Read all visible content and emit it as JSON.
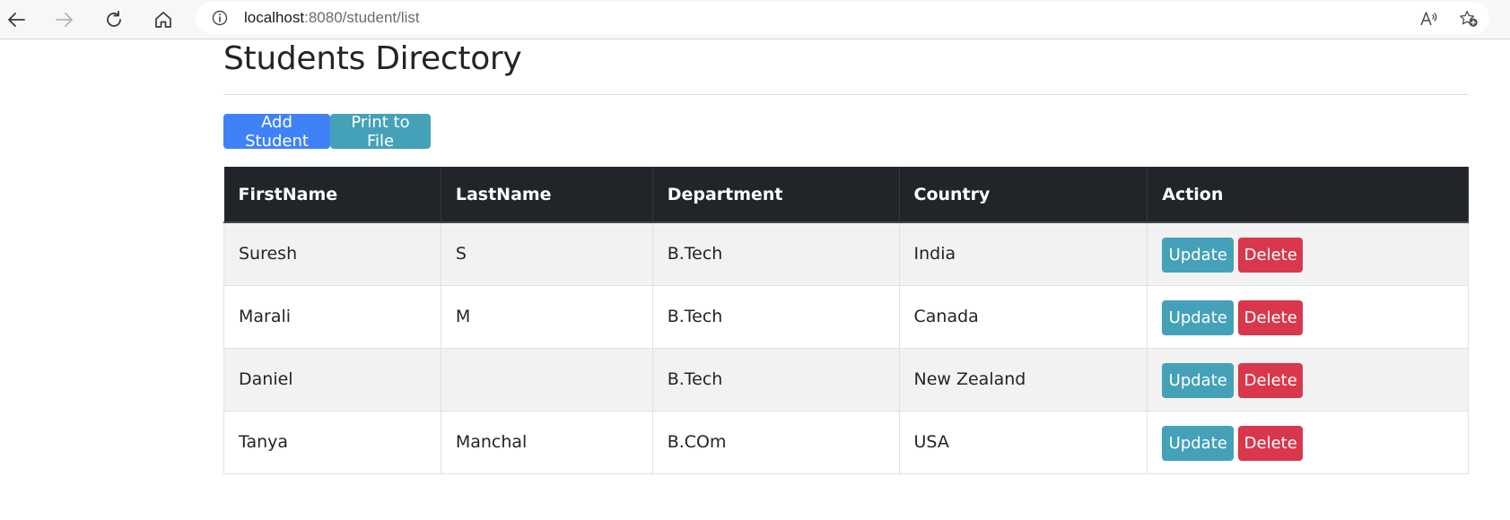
{
  "browser": {
    "url_host": "localhost",
    "url_path": ":8080/student/list"
  },
  "page": {
    "title": "Students Directory",
    "add_button_label": "Add Student",
    "print_button_label": "Print to File"
  },
  "table": {
    "headers": [
      "FirstName",
      "LastName",
      "Department",
      "Country",
      "Action"
    ],
    "update_label": "Update",
    "delete_label": "Delete",
    "rows": [
      {
        "first_name": "Suresh",
        "last_name": "S",
        "department": "B.Tech",
        "country": "India"
      },
      {
        "first_name": "Marali",
        "last_name": "M",
        "department": "B.Tech",
        "country": "Canada"
      },
      {
        "first_name": "Daniel",
        "last_name": "",
        "department": "B.Tech",
        "country": "New Zealand"
      },
      {
        "first_name": "Tanya",
        "last_name": "Manchal",
        "department": "B.COm",
        "country": "USA"
      }
    ]
  },
  "colors": {
    "primary": "#3f82f7",
    "info": "#45a1b8",
    "danger": "#d9374b",
    "header_dark": "#212529"
  }
}
